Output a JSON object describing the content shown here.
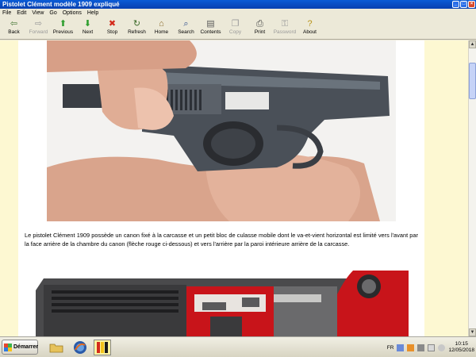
{
  "window": {
    "title": "Pistolet Clément modèle 1909 expliqué",
    "buttons": {
      "minimize": "_",
      "maximize": "□",
      "close": "×"
    }
  },
  "menu": [
    "File",
    "Edit",
    "View",
    "Go",
    "Options",
    "Help"
  ],
  "toolbar": [
    {
      "id": "back",
      "label": "Back",
      "icon": "back-arrow-icon",
      "glyph": "⇦",
      "color": "#4a7a3a",
      "enabled": true
    },
    {
      "id": "forward",
      "label": "Forward",
      "icon": "forward-arrow-icon",
      "glyph": "⇨",
      "color": "#9a9a9a",
      "enabled": false
    },
    {
      "id": "previous",
      "label": "Previous",
      "icon": "up-arrow-icon",
      "glyph": "⬆",
      "color": "#2e9e2e",
      "enabled": true
    },
    {
      "id": "next",
      "label": "Next",
      "icon": "down-arrow-icon",
      "glyph": "⬇",
      "color": "#2e9e2e",
      "enabled": true
    },
    {
      "id": "stop",
      "label": "Stop",
      "icon": "stop-icon",
      "glyph": "✖",
      "color": "#d42a1a",
      "enabled": true
    },
    {
      "id": "refresh",
      "label": "Refresh",
      "icon": "refresh-icon",
      "glyph": "↻",
      "color": "#3c6a2a",
      "enabled": true
    },
    {
      "id": "home",
      "label": "Home",
      "icon": "home-icon",
      "glyph": "⌂",
      "color": "#8a6a2a",
      "enabled": true
    },
    {
      "id": "search",
      "label": "Search",
      "icon": "search-icon",
      "glyph": "⌕",
      "color": "#2a4a8a",
      "enabled": true
    },
    {
      "id": "contents",
      "label": "Contents",
      "icon": "contents-icon",
      "glyph": "▤",
      "color": "#5a5a5a",
      "enabled": true
    },
    {
      "id": "copy",
      "label": "Copy",
      "icon": "copy-icon",
      "glyph": "❐",
      "color": "#9a9a9a",
      "enabled": false
    },
    {
      "id": "print",
      "label": "Print",
      "icon": "print-icon",
      "glyph": "⎙",
      "color": "#4a4a4a",
      "enabled": true
    },
    {
      "id": "password",
      "label": "Password",
      "icon": "key-icon",
      "glyph": "⚿",
      "color": "#9a9a9a",
      "enabled": false
    },
    {
      "id": "about",
      "label": "About",
      "icon": "about-icon",
      "glyph": "?",
      "color": "#b8941a",
      "enabled": true
    }
  ],
  "content": {
    "paragraph": "Le pistolet Clément 1909 possède un canon fixé à la carcasse et un petit bloc de culasse mobile dont le va-et-vient horizontal est limité vers l'avant par la face arrière de la chambre du canon (flèche rouge ci-dessous) et vers l'arrière par la paroi intérieure arrière de la carcasse."
  },
  "taskbar": {
    "start_label": "Démarrer",
    "language": "FR",
    "time": "10:15",
    "date": "12/05/2018"
  },
  "colors": {
    "page_background": "#fdf8d2",
    "titlebar": "#0a5bd6",
    "diagram_red": "#c8141a"
  }
}
